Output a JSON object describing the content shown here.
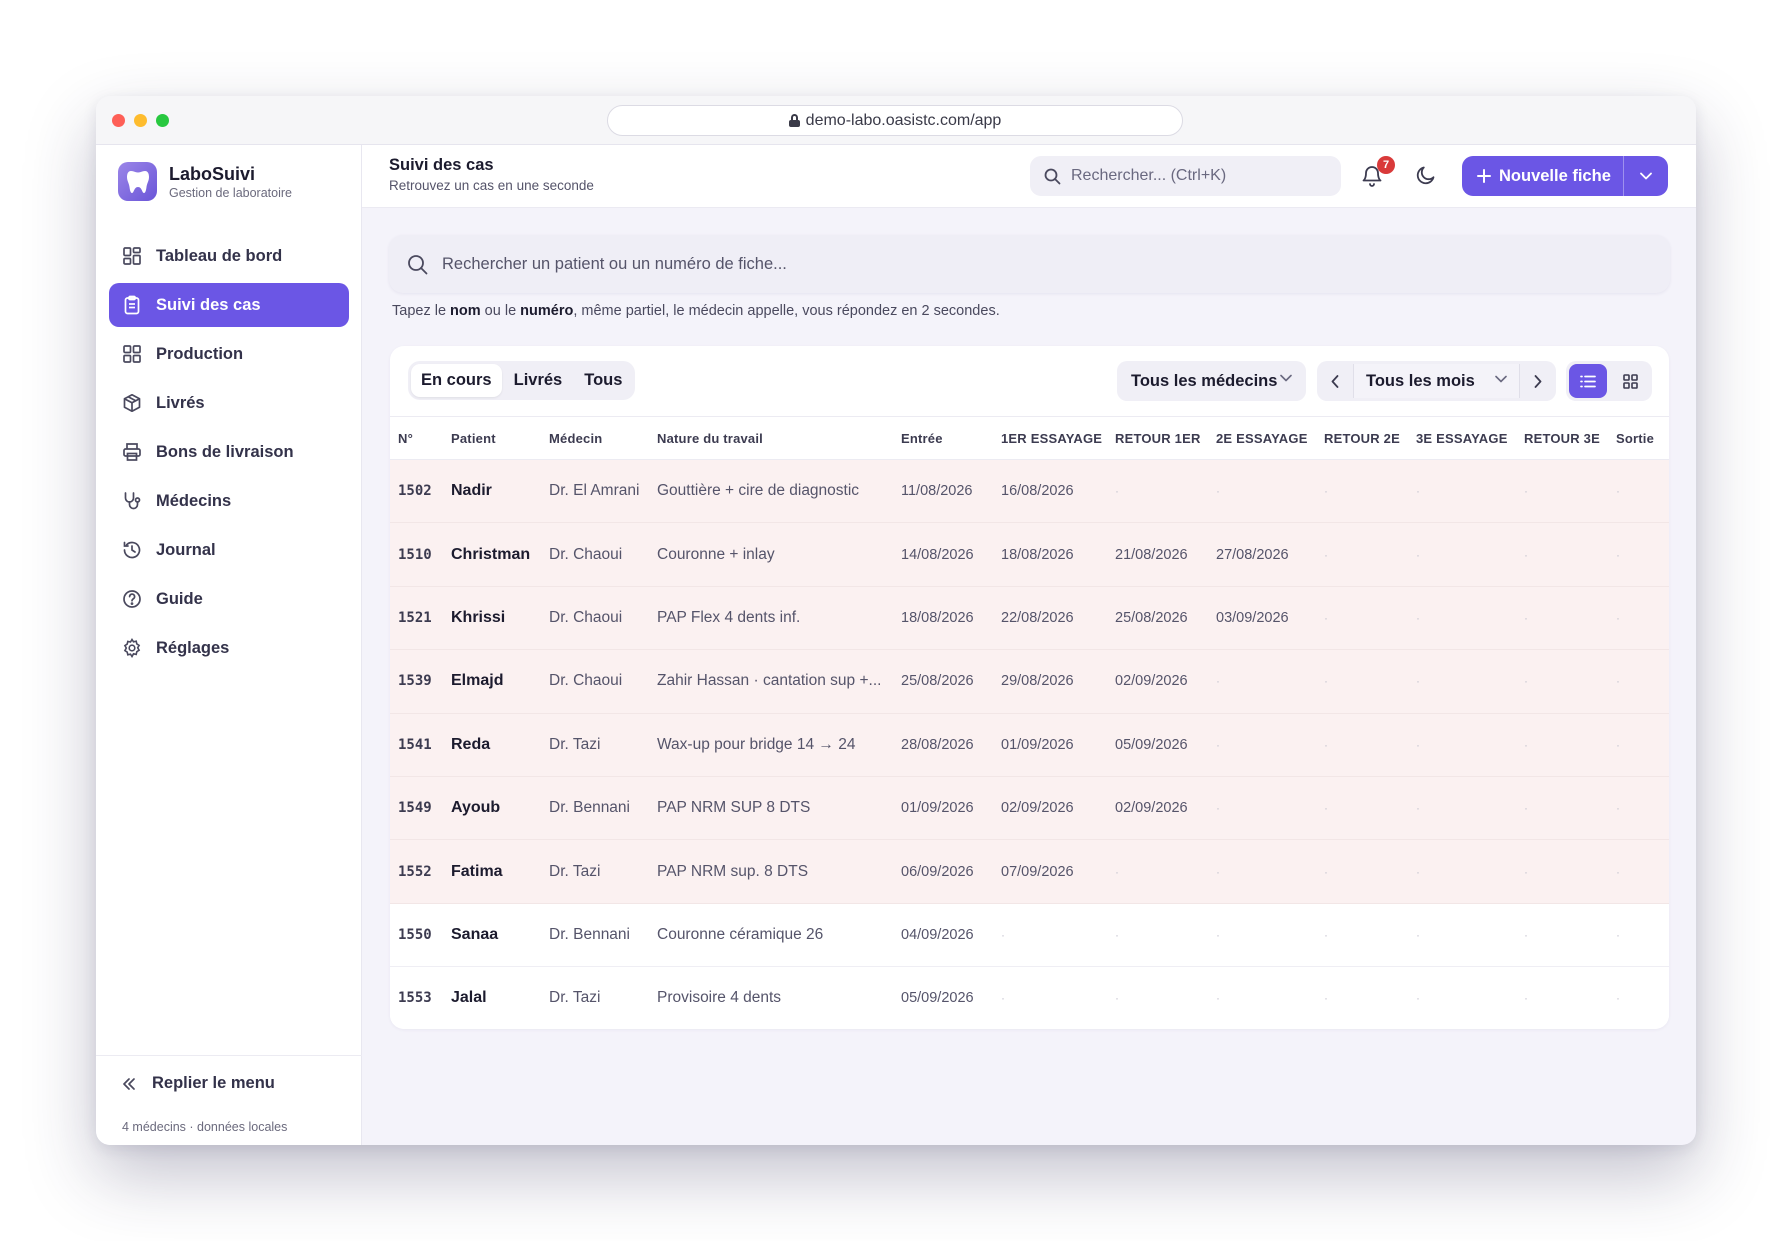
{
  "browser": {
    "url": "demo-labo.oasistc.com/app"
  },
  "brand": {
    "name": "LaboSuivi",
    "subtitle": "Gestion de laboratoire"
  },
  "sidebar": {
    "items": [
      {
        "label": "Tableau de bord",
        "icon": "dashboard-icon"
      },
      {
        "label": "Suivi des cas",
        "icon": "clipboard-icon",
        "active": true
      },
      {
        "label": "Production",
        "icon": "grid-icon"
      },
      {
        "label": "Livrés",
        "icon": "package-icon"
      },
      {
        "label": "Bons de livraison",
        "icon": "printer-icon"
      },
      {
        "label": "Médecins",
        "icon": "stethoscope-icon"
      },
      {
        "label": "Journal",
        "icon": "history-icon"
      },
      {
        "label": "Guide",
        "icon": "help-icon"
      },
      {
        "label": "Réglages",
        "icon": "settings-icon"
      }
    ],
    "collapse_label": "Replier le menu",
    "footer_note": "4 médecins · données locales"
  },
  "header": {
    "title": "Suivi des cas",
    "subtitle": "Retrouvez un cas en une seconde",
    "search_placeholder": "Rechercher...  (Ctrl+K)",
    "notification_count": "7",
    "new_button_label": "Nouvelle fiche"
  },
  "main": {
    "search_placeholder": "Rechercher un patient ou un numéro de fiche...",
    "hint": {
      "before": "Tapez le ",
      "b1": "nom",
      "mid": " ou le ",
      "b2": "numéro",
      "after": ", même partiel, le médecin appelle, vous répondez en 2 secondes."
    },
    "tabs": [
      {
        "label": "En cours",
        "active": true
      },
      {
        "label": "Livrés"
      },
      {
        "label": "Tous"
      }
    ],
    "doctor_filter": "Tous les médecins",
    "month_filter": "Tous les mois",
    "view_mode": "list"
  },
  "table": {
    "columns": [
      "N°",
      "Patient",
      "Médecin",
      "Nature du travail",
      "Entrée",
      "1ER ESSAYAGE",
      "RETOUR 1ER",
      "2E ESSAYAGE",
      "RETOUR 2E",
      "3E ESSAYAGE",
      "RETOUR 3E",
      "Sortie"
    ],
    "empty_mark": "·",
    "rows": [
      {
        "num": "1502",
        "patient": "Nadir",
        "doctor": "Dr. El Amrani",
        "work": "Gouttière + cire de diagnostic",
        "entry": "11/08/2026",
        "e1": "16/08/2026",
        "r1": "",
        "e2": "",
        "r2": "",
        "e3": "",
        "r3": "",
        "out": "",
        "status": "pending"
      },
      {
        "num": "1510",
        "patient": "Christman",
        "doctor": "Dr. Chaoui",
        "work": "Couronne + inlay",
        "entry": "14/08/2026",
        "e1": "18/08/2026",
        "r1": "21/08/2026",
        "e2": "27/08/2026",
        "r2": "",
        "e3": "",
        "r3": "",
        "out": "",
        "status": "pending"
      },
      {
        "num": "1521",
        "patient": "Khrissi",
        "doctor": "Dr. Chaoui",
        "work": "PAP Flex 4 dents inf.",
        "entry": "18/08/2026",
        "e1": "22/08/2026",
        "r1": "25/08/2026",
        "e2": "03/09/2026",
        "r2": "",
        "e3": "",
        "r3": "",
        "out": "",
        "status": "pending"
      },
      {
        "num": "1539",
        "patient": "Elmajd",
        "doctor": "Dr. Chaoui",
        "work": "Zahir Hassan · cantation sup +...",
        "entry": "25/08/2026",
        "e1": "29/08/2026",
        "r1": "02/09/2026",
        "e2": "",
        "r2": "",
        "e3": "",
        "r3": "",
        "out": "",
        "status": "pending"
      },
      {
        "num": "1541",
        "patient": "Reda",
        "doctor": "Dr. Tazi",
        "work": "Wax-up pour bridge 14 → 24",
        "entry": "28/08/2026",
        "e1": "01/09/2026",
        "r1": "05/09/2026",
        "e2": "",
        "r2": "",
        "e3": "",
        "r3": "",
        "out": "",
        "status": "pending"
      },
      {
        "num": "1549",
        "patient": "Ayoub",
        "doctor": "Dr. Bennani",
        "work": "PAP NRM SUP 8 DTS",
        "entry": "01/09/2026",
        "e1": "02/09/2026",
        "r1": "02/09/2026",
        "e2": "",
        "r2": "",
        "e3": "",
        "r3": "",
        "out": "",
        "status": "pending"
      },
      {
        "num": "1552",
        "patient": "Fatima",
        "doctor": "Dr. Tazi",
        "work": "PAP NRM sup. 8 DTS",
        "entry": "06/09/2026",
        "e1": "07/09/2026",
        "r1": "",
        "e2": "",
        "r2": "",
        "e3": "",
        "r3": "",
        "out": "",
        "status": "pending"
      },
      {
        "num": "1550",
        "patient": "Sanaa",
        "doctor": "Dr. Bennani",
        "work": "Couronne céramique 26",
        "entry": "04/09/2026",
        "e1": "",
        "r1": "",
        "e2": "",
        "r2": "",
        "e3": "",
        "r3": "",
        "out": "",
        "status": "plain"
      },
      {
        "num": "1553",
        "patient": "Jalal",
        "doctor": "Dr. Tazi",
        "work": "Provisoire 4 dents",
        "entry": "05/09/2026",
        "e1": "",
        "r1": "",
        "e2": "",
        "r2": "",
        "e3": "",
        "r3": "",
        "out": "",
        "status": "plain"
      }
    ]
  },
  "colors": {
    "accent": "#6b56e5",
    "pending_row": "#fbf1f1",
    "badge": "#d93a3a"
  }
}
